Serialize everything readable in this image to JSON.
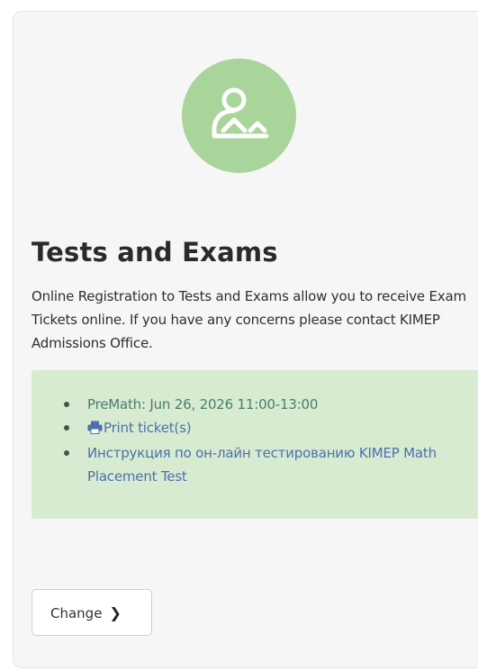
{
  "card": {
    "icon": "patient-bed-icon",
    "icon_color": "#a9d49a",
    "title": "Tests and Exams",
    "description": "Online Registration to Tests and Exams allow you to receive Exam Tickets online. If you have any concerns please contact KIMEP Admissions Office.",
    "info_box_color": "#d7ebd0",
    "items": [
      {
        "text": "PreMath: Jun 26, 2026 11:00-13:00"
      },
      {
        "text": "Print ticket(s)",
        "icon": "printer-icon"
      },
      {
        "text": "Инструкция по он-лайн тестированию KIMEP Math Placement Test"
      }
    ],
    "change_label": "Change",
    "change_icon": "chevron-right-icon"
  }
}
